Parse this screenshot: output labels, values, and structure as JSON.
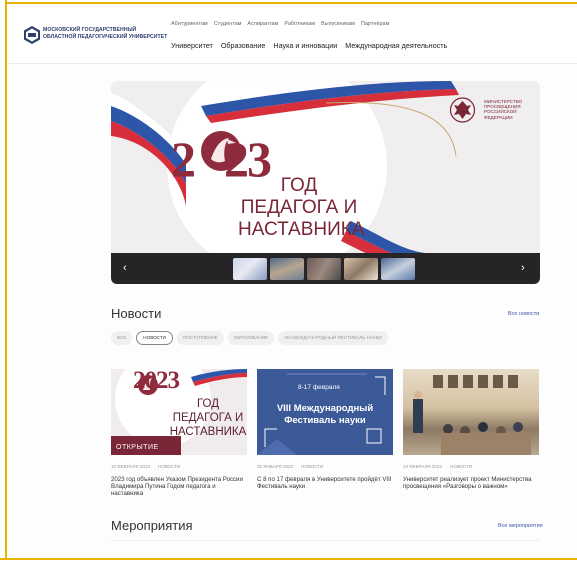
{
  "header": {
    "university_name": "МОСКОВСКИЙ ГОСУДАРСТВЕННЫЙ ОБЛАСТНОЙ ПЕДАГОГИЧЕСКИЙ УНИВЕРСИТЕТ",
    "top_links": [
      "Абитуриентам",
      "Студентам",
      "Аспирантам",
      "Работникам",
      "Выпускникам",
      "Партнёрам"
    ],
    "main_nav": [
      "Университет",
      "Образование",
      "Наука и инновации",
      "Международная деятельность"
    ]
  },
  "banner": {
    "year_prefix": "2",
    "year_suffix": "23",
    "title": "ГОД ПЕДАГОГА И НАСТАВНИКА",
    "ministry": "МИНИСТЕРСТВО ПРОСВЕЩЕНИЯ РОССИЙСКОЙ ФЕДЕРАЦИИ",
    "prev_arrow": "‹",
    "next_arrow": "›"
  },
  "news": {
    "title": "Новости",
    "all_link": "Все новости",
    "filters": [
      "ВСЕ",
      "НОВОСТИ",
      "ПОСТУПЛЕНИЕ",
      "ОБРАЗОВАНИЕ",
      "VIII МЕЖДУНАРОДНЫЙ ФЕСТИВАЛЬ НАУКИ"
    ],
    "active_filter": "НОВОСТИ",
    "cards": [
      {
        "date": "10 ФЕВРАЛЯ 2023",
        "category": "НОВОСТИ",
        "text": "2023 год объявлен Указом Президента России Владимира Путина Годом педагога и наставника",
        "image_year": "2023",
        "image_title": "ГОД ПЕДАГОГА И НАСТАВНИКА",
        "image_ribbon": "ОТКРЫТИЕ"
      },
      {
        "date": "30 ЯНВАРЯ 2023",
        "category": "НОВОСТИ",
        "text": "С 8 по 17 февраля в Университете пройдёт VIII Фестиваль науки",
        "image_date": "8-17 февраля",
        "image_title": "VIII Международный Фестиваль науки"
      },
      {
        "date": "10 ФЕВРАЛЯ 2023",
        "category": "НОВОСТИ",
        "text": "Университет реализует проект Министерства просвещения «Разговоры о важном»"
      }
    ]
  },
  "events": {
    "title": "Мероприятия",
    "all_link": "Все мероприятия"
  },
  "colors": {
    "accent": "#3b5aa6",
    "brand_burgundy": "#8e2c3e",
    "festival_blue": "#3d5a98",
    "frame_yellow": "#e4b400"
  }
}
